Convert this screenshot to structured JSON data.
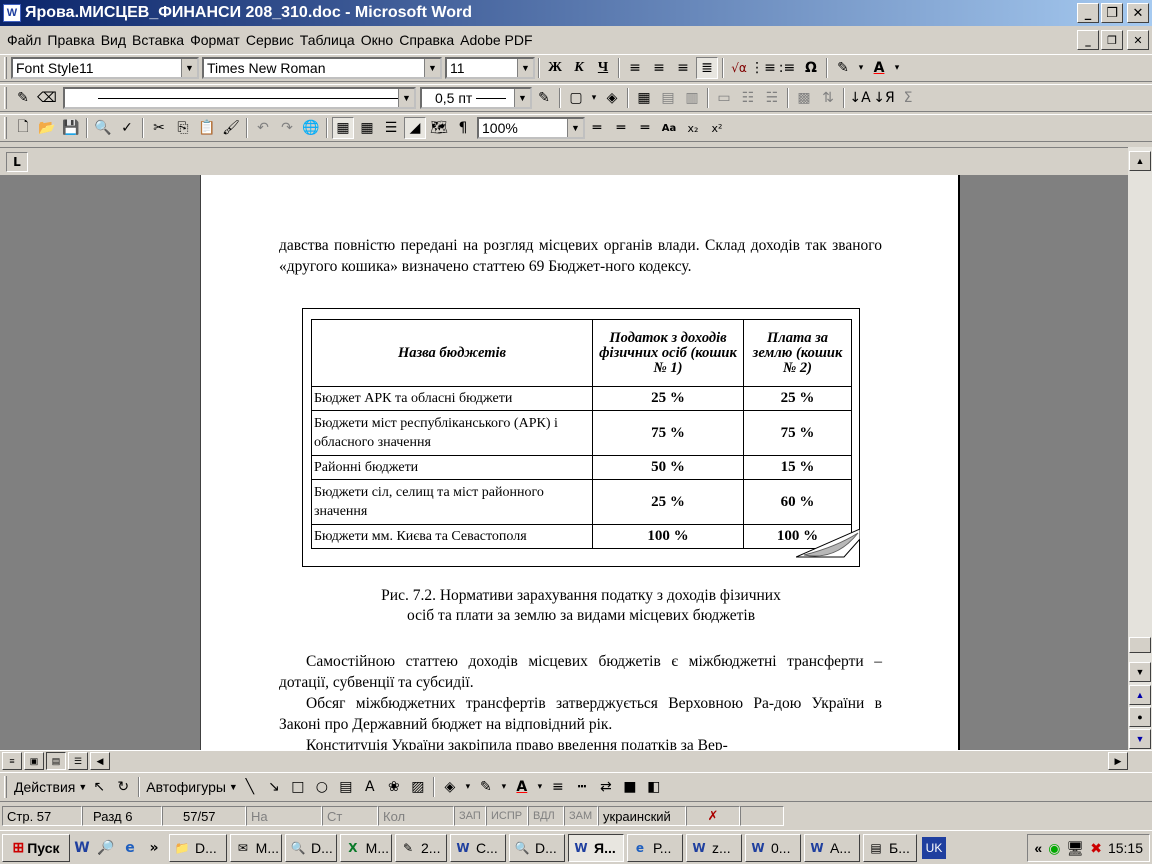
{
  "window": {
    "title": "Ярова.МИСЦЕВ_ФИНАНСИ 208_310.doc - Microsoft Word"
  },
  "menu": [
    "Файл",
    "Правка",
    "Вид",
    "Вставка",
    "Формат",
    "Сервис",
    "Таблица",
    "Окно",
    "Справка",
    "Adobe PDF"
  ],
  "formatting": {
    "style": "Font Style11",
    "font": "Times New Roman",
    "size": "11"
  },
  "tables_borders": {
    "line_weight": "0,5 пт"
  },
  "standard": {
    "zoom": "100%"
  },
  "document": {
    "para1": "давства повністю передані на розгляд місцевих органів влади. Склад доходів так званого «другого кошика» визначено статтею 69 Бюджет-ного кодексу.",
    "table": {
      "headers": [
        "Назва бюджетів",
        "Податок з доходів фізичних осіб (кошик № 1)",
        "Плата за землю (кошик № 2)"
      ],
      "rows": [
        [
          "Бюджет АРК та обласні бюджети",
          "25 %",
          "25 %"
        ],
        [
          "Бюджети міст республіканського (АРК) і обласного значення",
          "75 %",
          "75 %"
        ],
        [
          "Районні бюджети",
          "50 %",
          "15 %"
        ],
        [
          "Бюджети сіл, селищ та міст районного значення",
          "25 %",
          "60 %"
        ],
        [
          "Бюджети мм. Києва та Севастополя",
          "100 %",
          "100 %"
        ]
      ]
    },
    "caption_line1": "Рис. 7.2. Нормативи зарахування податку з доходів фізичних",
    "caption_line2": "осіб та плати за землю за видами місцевих бюджетів",
    "para2": "Самостійною статтею доходів місцевих бюджетів є міжбюджетні трансферти – дотації, субвенції та субсидії.",
    "para3": "Обсяг міжбюджетних трансфертів затверджується Верховною Ра-дою України в Законі про Державний бюджет на відповідний рік.",
    "para4": "Конституція України закріпила право введення податків за Вер-"
  },
  "drawing": {
    "actions": "Действия",
    "autoshapes": "Автофигуры"
  },
  "status": {
    "page": "Стр. 57",
    "section": "Разд 6",
    "pages": "57/57",
    "at": "На",
    "line": "Ст",
    "col": "Кол",
    "rec": "ЗАП",
    "trk": "ИСПР",
    "ext": "ВДЛ",
    "ovr": "ЗАМ",
    "lang": "украинский"
  },
  "taskbar": {
    "start": "Пуск",
    "tasks": [
      "D...",
      "M...",
      "D...",
      "M...",
      "2...",
      "С...",
      "D...",
      "Я...",
      "Р...",
      "z...",
      "0...",
      "А...",
      "Б..."
    ],
    "lang": "UK",
    "clock": "15:15"
  }
}
